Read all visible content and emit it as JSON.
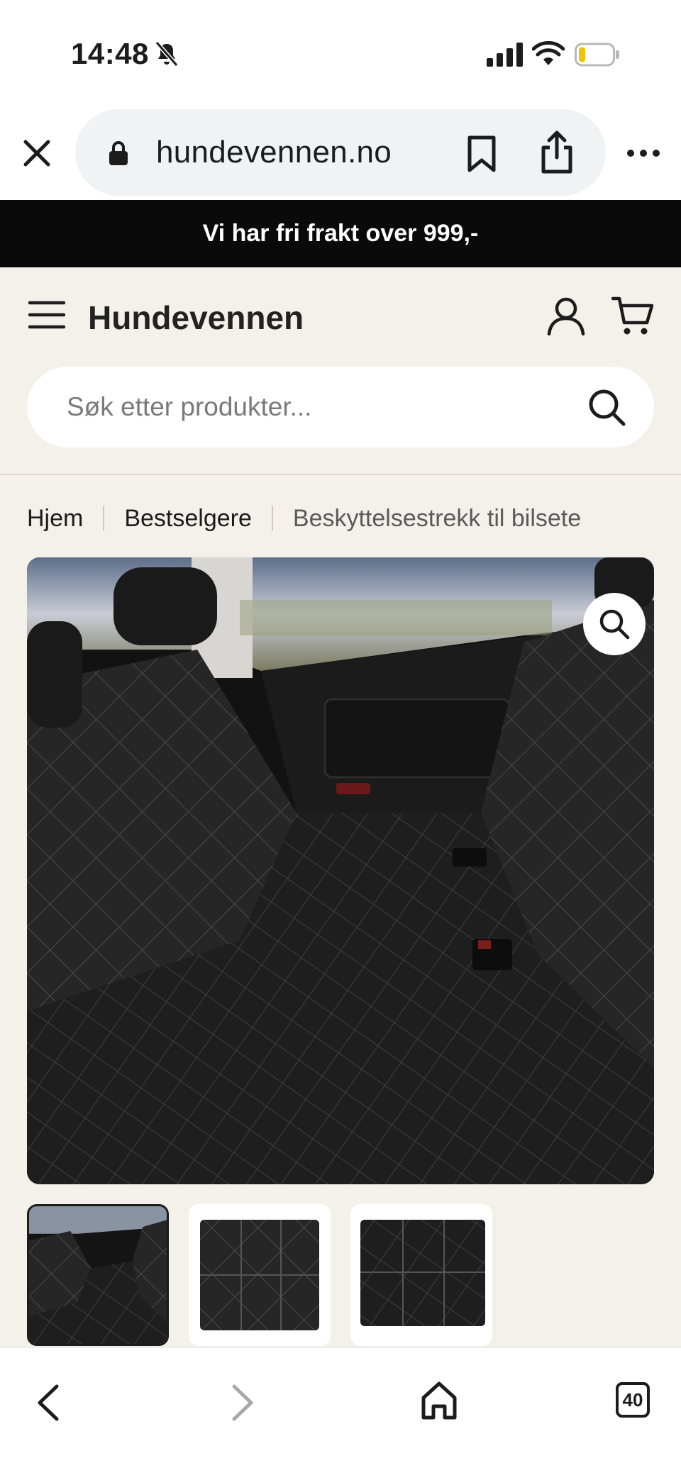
{
  "status_bar": {
    "time": "14:48",
    "icons": [
      "bell-off-icon",
      "signal-icon",
      "wifi-icon",
      "battery-icon"
    ],
    "battery_level": 0.2
  },
  "browser": {
    "url": "hundevennen.no",
    "icons": [
      "close-icon",
      "lock-icon",
      "bookmark-icon",
      "share-icon",
      "more-icon"
    ]
  },
  "announcement": {
    "text": "Vi har fri frakt over 999,-"
  },
  "header": {
    "logo": "Hundevennen",
    "search_placeholder": "Søk etter produkter...",
    "icons": [
      "menu-icon",
      "account-icon",
      "cart-icon",
      "search-icon"
    ]
  },
  "breadcrumb": {
    "items": [
      {
        "label": "Hjem"
      },
      {
        "label": "Bestselgere"
      },
      {
        "label": "Beskyttelsestrekk til bilsete"
      }
    ]
  },
  "gallery": {
    "thumbnail_count": 3,
    "active_index": 0,
    "zoom_icon": "zoom-icon"
  },
  "toolbar": {
    "tab_count": "40",
    "icons": [
      "back-icon",
      "forward-icon",
      "home-icon",
      "tabs-icon"
    ]
  },
  "colors": {
    "announcement_bg": "#0a0a0a",
    "header_bg": "#f4f0ea",
    "text": "#1c1c1c",
    "battery_fill": "#f2c200"
  }
}
